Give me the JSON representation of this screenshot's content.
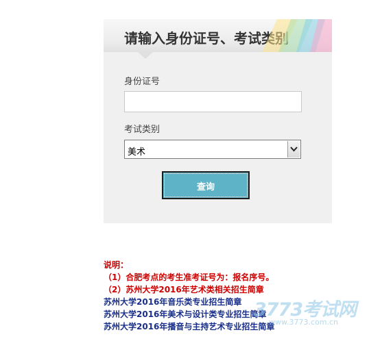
{
  "form": {
    "title": "请输入身份证号、考试类别",
    "id_label": "身份证号",
    "id_value": "",
    "id_placeholder": "",
    "category_label": "考试类别",
    "category_selected": "美术",
    "query_button": "查询"
  },
  "notes": {
    "heading": "说明：",
    "lines": [
      "（1）合肥考点的考生准考证号为：报名序号。",
      "（2）苏州大学2016年艺术类相关招生简章"
    ],
    "links": [
      "苏州大学2016年音乐类专业招生简章",
      "苏州大学2016年美术与设计类专业招生简章",
      "苏州大学2016年播音与主持艺术专业招生简章"
    ]
  },
  "watermark": {
    "brand": "3773考试网",
    "site": "www.3773.com.cn"
  },
  "colors": {
    "button": "#5fb3c7",
    "note_red": "#cc0000",
    "link_blue": "#1a2f88",
    "panel_bg": "#f0f0f0"
  },
  "icons": {
    "dropdown": "chevron-down-icon"
  }
}
